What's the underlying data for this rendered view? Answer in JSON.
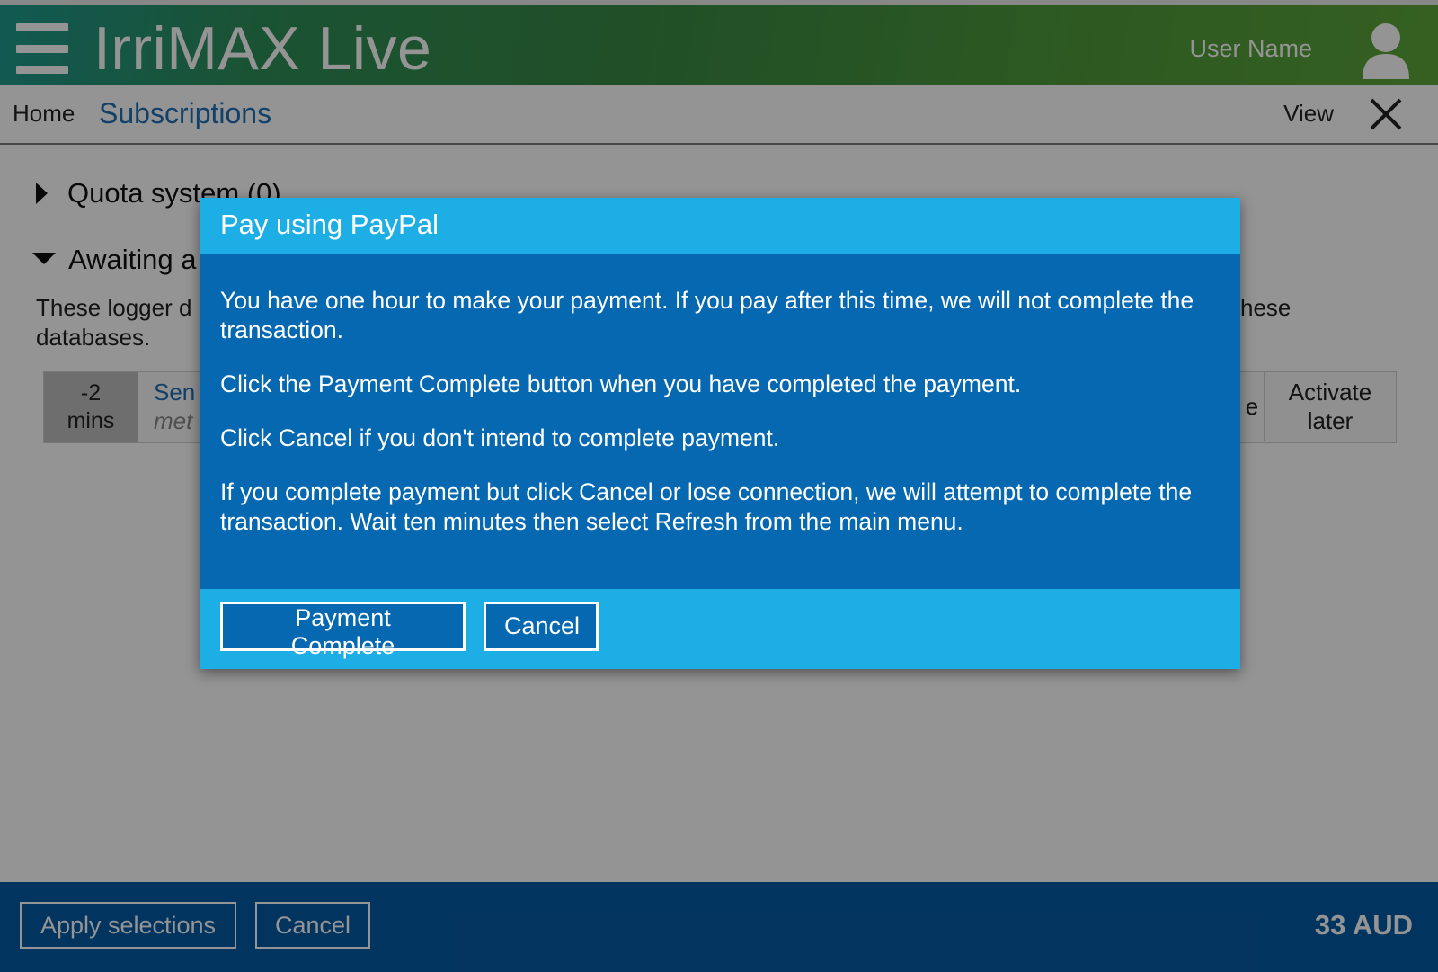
{
  "header": {
    "app_title": "IrriMAX Live",
    "user_name": "User Name",
    "menu_icon": "hamburger-menu-icon",
    "avatar_icon": "user-icon",
    "colors": {
      "gradient_start": "#1f9a8f",
      "gradient_end": "#5da63a"
    }
  },
  "nav": {
    "home": "Home",
    "current": "Subscriptions",
    "view": "View",
    "close_icon": "close-icon"
  },
  "content": {
    "quota_section": "Quota system (0)",
    "awaiting_section": "Awaiting a",
    "description_line1": "These logger d",
    "description_line1_end": "hese",
    "description_line2": "databases.",
    "row": {
      "time_value": "-2",
      "time_unit": "mins",
      "name": "Sen",
      "meta": "met",
      "partial_button": "e",
      "activate_later": "Activate later"
    }
  },
  "footer": {
    "apply_label": "Apply selections",
    "cancel_label": "Cancel",
    "total": "33 AUD",
    "color": "#055aa6"
  },
  "modal": {
    "title": "Pay using PayPal",
    "paragraphs": [
      "You have one hour to make your payment. If you pay after this time, we will not complete the transaction.",
      "Click the Payment Complete button when you have completed the payment.",
      "Click Cancel if you don't intend to complete payment.",
      "If you complete payment but click Cancel or lose connection, we will attempt to complete the transaction. Wait ten minutes then select Refresh from the main menu."
    ],
    "payment_complete_label": "Payment Complete",
    "cancel_label": "Cancel",
    "colors": {
      "header": "#1eaee6",
      "body": "#0568b1"
    }
  }
}
